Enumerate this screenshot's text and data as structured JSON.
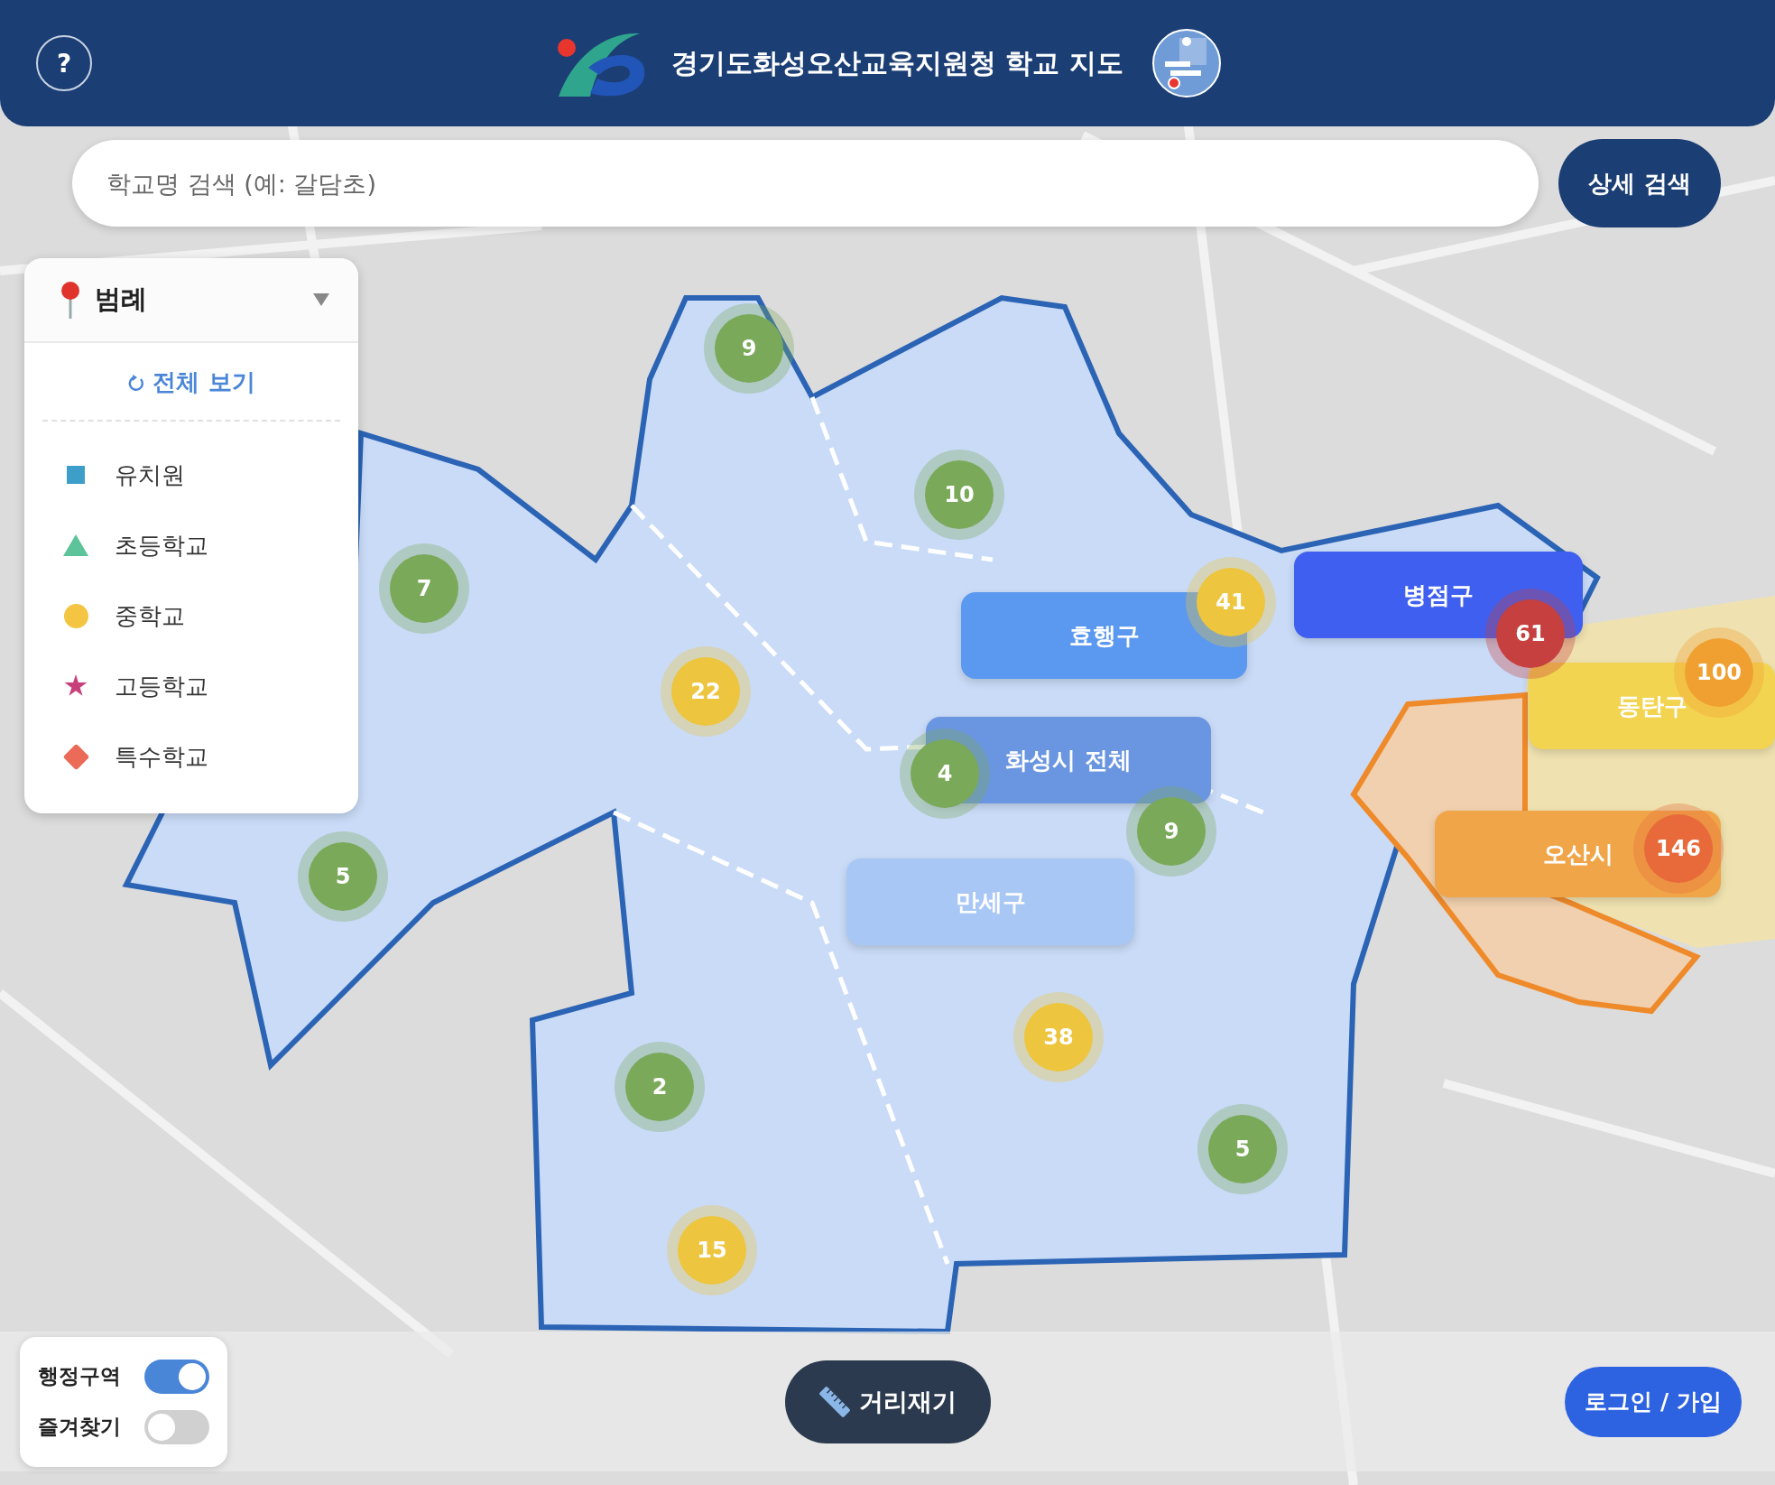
{
  "header": {
    "help_button": "?",
    "title": "경기도화성오산교육지원청 학교 지도"
  },
  "search": {
    "placeholder": "학교명 검색 (예: 갈담초)",
    "button": "상세 검색"
  },
  "legend": {
    "title": "범례",
    "reset": "전체 보기",
    "items": [
      {
        "label": "유치원",
        "kind": "square",
        "color": "#3d9ec9"
      },
      {
        "label": "초등학교",
        "kind": "triangle",
        "color": "#5cc39a"
      },
      {
        "label": "중학교",
        "kind": "circle",
        "color": "#f4c542"
      },
      {
        "label": "고등학교",
        "kind": "star",
        "color": "#c8407a"
      },
      {
        "label": "특수학교",
        "kind": "diamond",
        "color": "#ec6a58"
      }
    ]
  },
  "region_labels": [
    {
      "label": "효행구",
      "color": "#5b98ef"
    },
    {
      "label": "병점구",
      "color": "#3f5ff0"
    },
    {
      "label": "동탄구",
      "color": "#f3d451"
    },
    {
      "label": "화성시 전체",
      "color": "#6a95e0"
    },
    {
      "label": "오산시",
      "color": "#f0a548"
    },
    {
      "label": "만세구",
      "color": "#a9c7f5"
    }
  ],
  "clusters": [
    {
      "count": "9",
      "color": "#7aa95a"
    },
    {
      "count": "10",
      "color": "#7aa95a"
    },
    {
      "count": "7",
      "color": "#7aa95a"
    },
    {
      "count": "22",
      "color": "#edc53e"
    },
    {
      "count": "41",
      "color": "#edc53e"
    },
    {
      "count": "61",
      "color": "#c5403f"
    },
    {
      "count": "100",
      "color": "#f0a030"
    },
    {
      "count": "146",
      "color": "#e86a3a"
    },
    {
      "count": "4",
      "color": "#7aa95a"
    },
    {
      "count": "9",
      "color": "#7aa95a"
    },
    {
      "count": "5",
      "color": "#7aa95a"
    },
    {
      "count": "38",
      "color": "#edc53e"
    },
    {
      "count": "2",
      "color": "#7aa95a"
    },
    {
      "count": "5",
      "color": "#7aa95a"
    },
    {
      "count": "15",
      "color": "#edc53e"
    }
  ],
  "toggles": [
    {
      "label": "행정구역",
      "on": true
    },
    {
      "label": "즐겨찾기",
      "on": false
    }
  ],
  "measure_button": "거리재기",
  "login_button": "로그인 / 가입"
}
